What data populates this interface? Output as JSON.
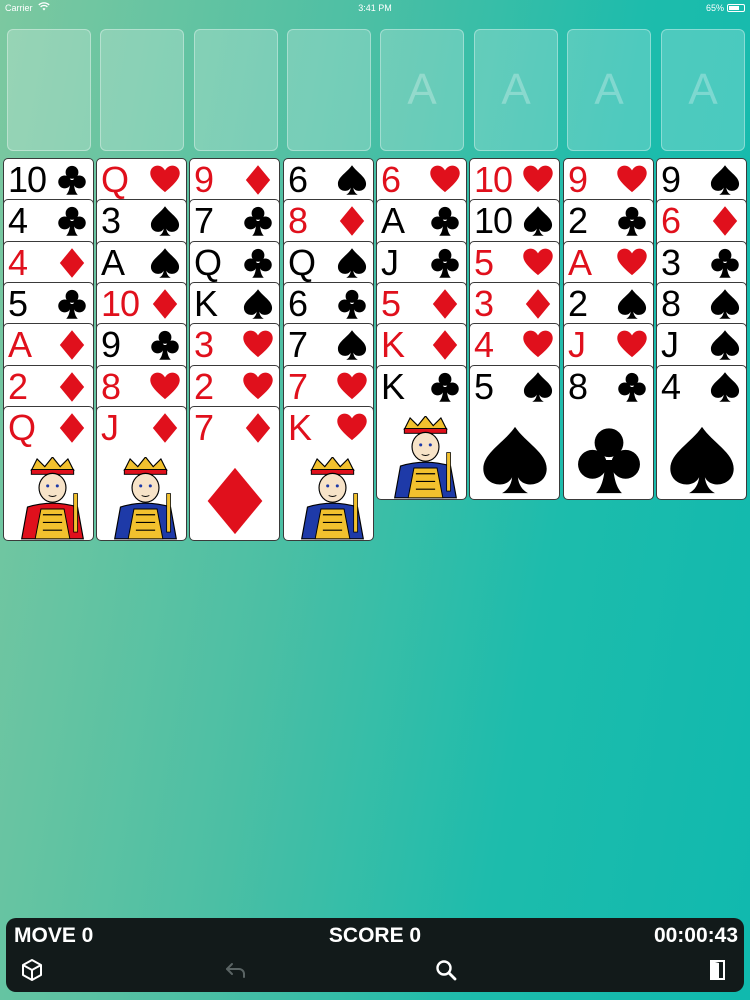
{
  "status_bar": {
    "carrier": "Carrier",
    "time": "3:41 PM",
    "battery": "65%"
  },
  "foundations": [
    {
      "label": ""
    },
    {
      "label": ""
    },
    {
      "label": ""
    },
    {
      "label": ""
    },
    {
      "label": "A"
    },
    {
      "label": "A"
    },
    {
      "label": "A"
    },
    {
      "label": "A"
    }
  ],
  "columns": [
    [
      {
        "rank": "10",
        "suit": "clubs"
      },
      {
        "rank": "4",
        "suit": "clubs"
      },
      {
        "rank": "4",
        "suit": "diamonds"
      },
      {
        "rank": "5",
        "suit": "clubs"
      },
      {
        "rank": "A",
        "suit": "diamonds"
      },
      {
        "rank": "2",
        "suit": "diamonds"
      },
      {
        "rank": "Q",
        "suit": "diamonds",
        "face": "queen"
      }
    ],
    [
      {
        "rank": "Q",
        "suit": "hearts"
      },
      {
        "rank": "3",
        "suit": "spades"
      },
      {
        "rank": "A",
        "suit": "spades"
      },
      {
        "rank": "10",
        "suit": "diamonds"
      },
      {
        "rank": "9",
        "suit": "clubs"
      },
      {
        "rank": "8",
        "suit": "hearts"
      },
      {
        "rank": "J",
        "suit": "diamonds",
        "face": "jack"
      }
    ],
    [
      {
        "rank": "9",
        "suit": "diamonds"
      },
      {
        "rank": "7",
        "suit": "clubs"
      },
      {
        "rank": "Q",
        "suit": "clubs"
      },
      {
        "rank": "K",
        "suit": "spades"
      },
      {
        "rank": "3",
        "suit": "hearts"
      },
      {
        "rank": "2",
        "suit": "hearts"
      },
      {
        "rank": "7",
        "suit": "diamonds"
      }
    ],
    [
      {
        "rank": "6",
        "suit": "spades"
      },
      {
        "rank": "8",
        "suit": "diamonds"
      },
      {
        "rank": "Q",
        "suit": "spades"
      },
      {
        "rank": "6",
        "suit": "clubs"
      },
      {
        "rank": "7",
        "suit": "spades"
      },
      {
        "rank": "7",
        "suit": "hearts"
      },
      {
        "rank": "K",
        "suit": "hearts",
        "face": "king"
      }
    ],
    [
      {
        "rank": "6",
        "suit": "hearts"
      },
      {
        "rank": "A",
        "suit": "clubs"
      },
      {
        "rank": "J",
        "suit": "clubs"
      },
      {
        "rank": "5",
        "suit": "diamonds"
      },
      {
        "rank": "K",
        "suit": "diamonds"
      },
      {
        "rank": "K",
        "suit": "clubs",
        "face": "king"
      }
    ],
    [
      {
        "rank": "10",
        "suit": "hearts"
      },
      {
        "rank": "10",
        "suit": "spades"
      },
      {
        "rank": "5",
        "suit": "hearts"
      },
      {
        "rank": "3",
        "suit": "diamonds"
      },
      {
        "rank": "4",
        "suit": "hearts"
      },
      {
        "rank": "5",
        "suit": "spades"
      }
    ],
    [
      {
        "rank": "9",
        "suit": "hearts"
      },
      {
        "rank": "2",
        "suit": "clubs"
      },
      {
        "rank": "A",
        "suit": "hearts"
      },
      {
        "rank": "2",
        "suit": "spades"
      },
      {
        "rank": "J",
        "suit": "hearts"
      },
      {
        "rank": "8",
        "suit": "clubs"
      }
    ],
    [
      {
        "rank": "9",
        "suit": "spades"
      },
      {
        "rank": "6",
        "suit": "diamonds"
      },
      {
        "rank": "3",
        "suit": "clubs"
      },
      {
        "rank": "8",
        "suit": "spades"
      },
      {
        "rank": "J",
        "suit": "spades"
      },
      {
        "rank": "4",
        "suit": "spades"
      }
    ]
  ],
  "toolbar": {
    "move": "MOVE 0",
    "score": "SCORE 0",
    "timer": "00:00:43",
    "buttons": [
      "cube-icon",
      "undo-icon",
      "search-icon",
      "exit-door-icon"
    ]
  },
  "colors": {
    "red": "#e0101c",
    "black": "#000000",
    "toolbar_bg": "#121a1a"
  }
}
